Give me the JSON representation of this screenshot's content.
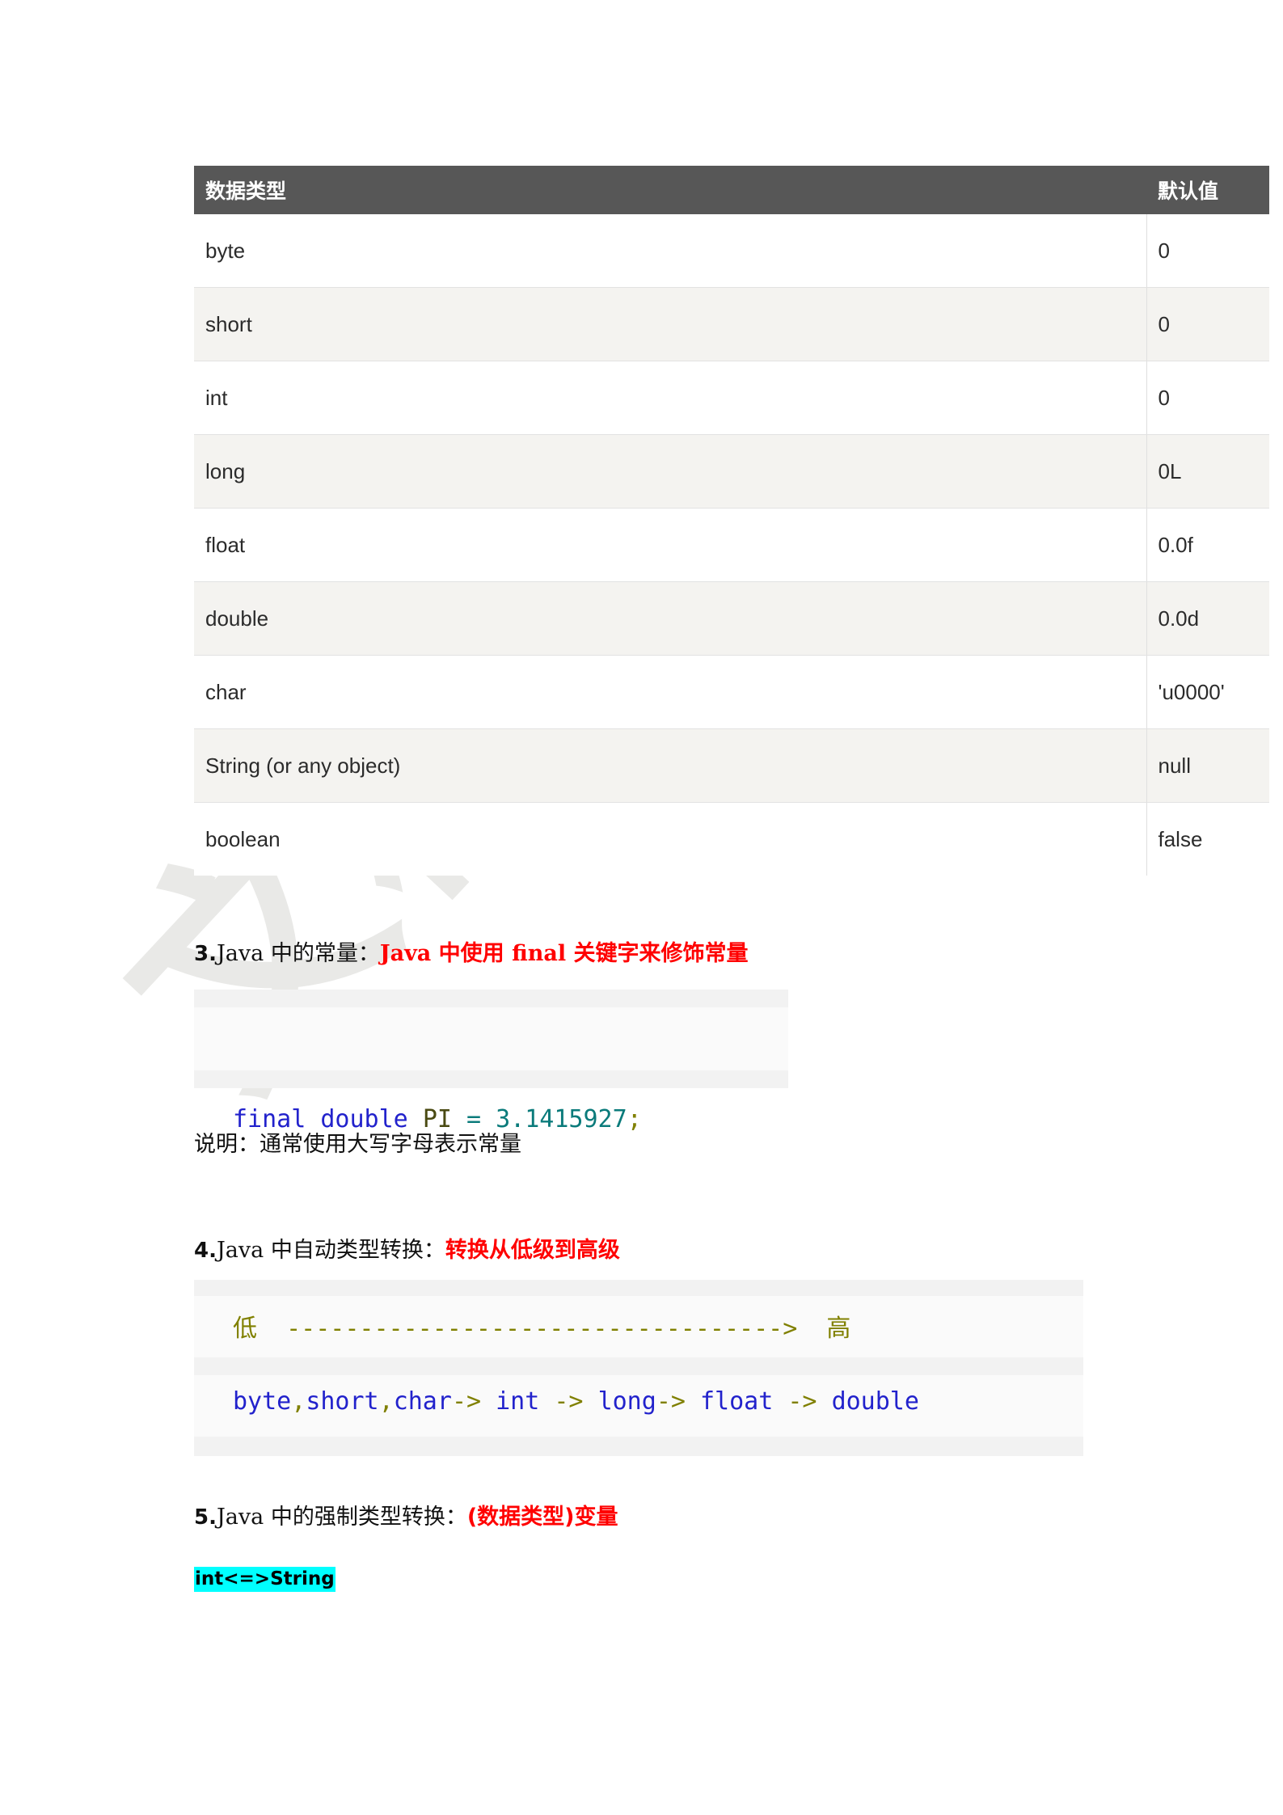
{
  "watermark": {
    "text": "文档良品"
  },
  "table": {
    "headers": {
      "type": "数据类型",
      "default": "默认值"
    },
    "rows": [
      {
        "type": "byte",
        "default": "0"
      },
      {
        "type": "short",
        "default": "0"
      },
      {
        "type": "int",
        "default": "0"
      },
      {
        "type": "long",
        "default": "0L"
      },
      {
        "type": "float",
        "default": "0.0f"
      },
      {
        "type": "double",
        "default": "0.0d"
      },
      {
        "type": "char",
        "default": "'u0000'"
      },
      {
        "type": "String (or any object)",
        "default": "null"
      },
      {
        "type": "boolean",
        "default": "false"
      }
    ]
  },
  "sections": {
    "sec3": {
      "number": "3.",
      "label_black": "Java 中的常量：",
      "label_red": "Java 中使用 final 关键字来修饰常量",
      "note": "说明：通常使用大写字母表示常量"
    },
    "sec4": {
      "number": "4.",
      "label_black": "Java 中自动类型转换：",
      "label_red": "转换从低级到高级"
    },
    "sec5": {
      "number": "5.",
      "label_black": "Java 中的强制类型转换：",
      "label_red": "(数据类型)变量",
      "highlight": "int<=>String"
    }
  },
  "code1": {
    "kw1": "final",
    "space1": " ",
    "kw2": "double",
    "space2": " ",
    "var": "PI",
    "space3": " ",
    "op": "=",
    "space4": " ",
    "num": "3.1415927",
    "semi": ";"
  },
  "code2": {
    "line1_low": "低",
    "line1_arrow": "  ---------------------------------->  ",
    "line1_high": "高",
    "line2": "byte,short,char-> int -> long-> float -> double",
    "line2_parts": {
      "byte": "byte",
      "comma1": ",",
      "short": "short",
      "comma2": ",",
      "char": "char",
      "arrow1": "-> ",
      "int": "int",
      "arrow2": " -> ",
      "long": "long",
      "arrow3": "-> ",
      "float": "float",
      "arrow4": " -> ",
      "double": "double"
    }
  },
  "colors": {
    "header_bg": "#575757",
    "row_alt_bg": "#f4f3f0",
    "accent_red": "#ff0000",
    "highlight_cyan": "#00ffff",
    "code_bg": "#f2f2f2",
    "keyword_blue": "#2222cc",
    "olive": "#808000"
  }
}
